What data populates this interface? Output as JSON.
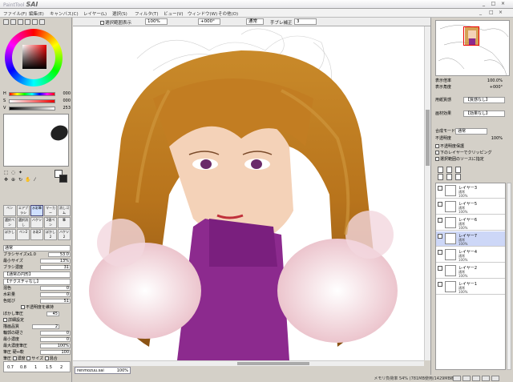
{
  "app": {
    "logo_small": "PaintTool",
    "logo": "SAI",
    "window_buttons": [
      "_",
      "□",
      "×"
    ]
  },
  "menu": {
    "items": [
      "ファイル(F)",
      "編集(E)",
      "キャンバス(C)",
      "レイヤー(L)",
      "選択(S)",
      "フィルタ(T)",
      "ビュー(V)",
      "ウィンドウ(W)",
      "その他(O)"
    ]
  },
  "canvas_bar": {
    "checkbox_label": "選択範囲表示",
    "zoom": "100%",
    "rotation": "+000°",
    "blend_mode": "通常",
    "stabilizer_label": "手ブレ補正",
    "stabilizer_value": "3"
  },
  "color": {
    "h_label": "H",
    "h_value": "000",
    "s_label": "S",
    "s_value": "000",
    "v_label": "V",
    "v_value": "253",
    "fg": "#ffffff",
    "bg": "#222222"
  },
  "tool_labels": [
    "ペン",
    "エアブラシ",
    "水彩筆",
    "マーカー",
    "消しゴム",
    "選択ペン",
    "選択消し",
    "バケツ",
    "2値ペン",
    "筆",
    "ぼかし",
    "ペン2",
    "水彩2",
    "ぼかし2",
    "バケツ2"
  ],
  "params": {
    "mode": "通常",
    "brush_size_label": "ブラシサイズ",
    "brush_size_mult": "x1.0",
    "brush_size": "53.0",
    "min_size_label": "最小サイズ",
    "min_size": "13%",
    "density_label": "ブラシ濃度",
    "density": "31",
    "shape": "【通常の円形】",
    "texture": "【テクスチャなし】",
    "blend_label": "混色",
    "blend_value": "0",
    "water_label": "水彩量",
    "water_value": "0",
    "persist_label": "色延び",
    "persist_value": "51",
    "opacity_keep_label": "不透明度を維持",
    "blur_label": "ぼかし筆圧",
    "blur_value": "45",
    "detail_label": "詳細設定",
    "quality_label": "描画品質",
    "quality_value": "2",
    "edge_label": "輪郭の硬さ",
    "edge_value": "0",
    "min_density_label": "最小濃度",
    "min_density_value": "0",
    "max_density_label": "最大濃度筆圧",
    "max_density_value": "100%",
    "pressure_label": "筆圧 硬⇔軟",
    "pressure_value": "100",
    "pressure_check_label": "筆圧",
    "density_check": "濃度",
    "size_check": "サイズ",
    "blend_check": "混合"
  },
  "brush_sizes": [
    "0.7",
    "0.8",
    "1",
    "1.5",
    "2"
  ],
  "doc": {
    "name": "renmozuu.sai",
    "zoom": "100%"
  },
  "status": {
    "memory": "メモリ負荷率 54% (781MB使用/1429MB確保)"
  },
  "right": {
    "zoom_label": "表示倍率",
    "zoom_value": "100.0%",
    "angle_label": "表示角度",
    "angle_value": "+000°",
    "clip_label": "用紙質感",
    "clip_value": "【質感なし】",
    "effect_label": "画材効果",
    "effect_value": "【効果なし】",
    "mode_label": "合成モード",
    "mode_value": "通常",
    "opacity_label": "不透明度",
    "opacity_value": "100%",
    "protect_label": "不透明度保護",
    "clip_group_label": "下のレイヤーでクリッピング",
    "select_source_label": "選択範囲のソースに指定"
  },
  "layers": [
    {
      "name": "レイヤー3",
      "mode": "通常",
      "opacity": "100%"
    },
    {
      "name": "レイヤー5",
      "mode": "通常",
      "opacity": "100%"
    },
    {
      "name": "レイヤー6",
      "mode": "通常",
      "opacity": "100%"
    },
    {
      "name": "レイヤー7",
      "mode": "通常",
      "opacity": "100%"
    },
    {
      "name": "レイヤー4",
      "mode": "通常",
      "opacity": "100%"
    },
    {
      "name": "レイヤー2",
      "mode": "通常",
      "opacity": "100%"
    },
    {
      "name": "レイヤー1",
      "mode": "通常",
      "opacity": "100%"
    }
  ]
}
